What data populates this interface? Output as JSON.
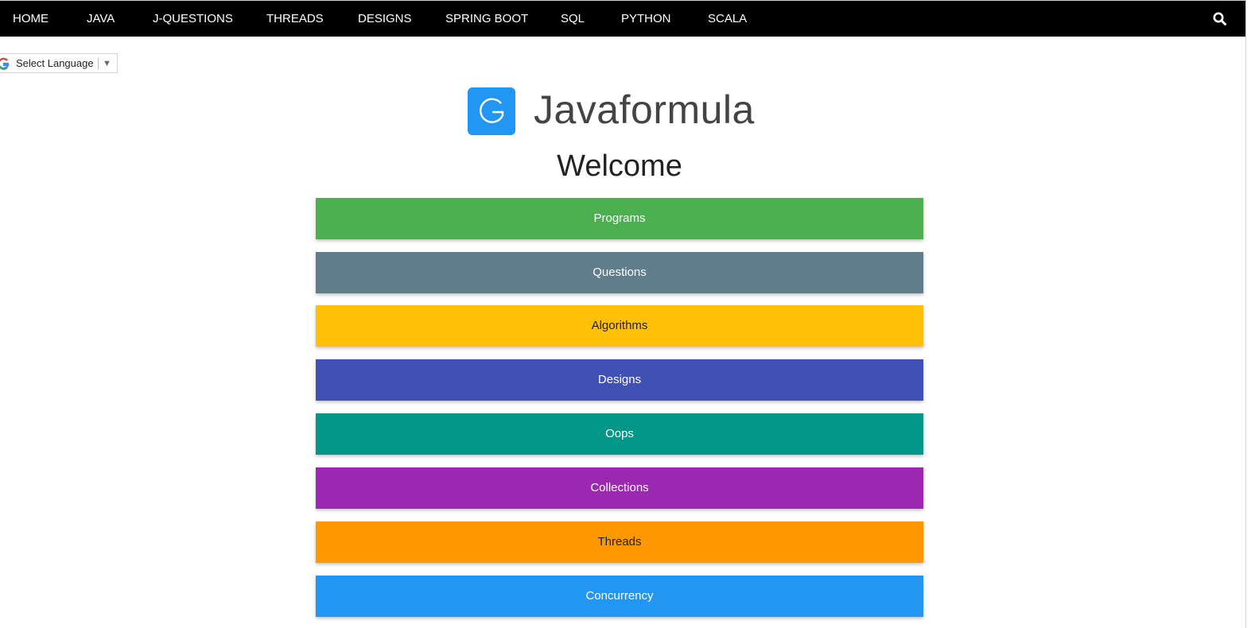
{
  "nav": {
    "items": [
      {
        "label": "HOME"
      },
      {
        "label": "JAVA"
      },
      {
        "label": "J-QUESTIONS"
      },
      {
        "label": "THREADS"
      },
      {
        "label": "DESIGNS"
      },
      {
        "label": "SPRING BOOT"
      },
      {
        "label": "SQL"
      },
      {
        "label": "PYTHON"
      },
      {
        "label": "SCALA"
      }
    ],
    "search_icon": "search-icon",
    "background": "#000000"
  },
  "translate": {
    "label": "Select Language",
    "arrow": "▼",
    "icon": "google-icon"
  },
  "logo": {
    "letter": "G",
    "text": "Javaformula",
    "color": "#2196f3"
  },
  "welcome": "Welcome",
  "categories": [
    {
      "label": "Programs",
      "color": "#4caf50",
      "text_color": "#ffffff"
    },
    {
      "label": "Questions",
      "color": "#607d8b",
      "text_color": "#ffffff"
    },
    {
      "label": "Algorithms",
      "color": "#ffc107",
      "text_color": "#222222"
    },
    {
      "label": "Designs",
      "color": "#3f51b5",
      "text_color": "#ffffff"
    },
    {
      "label": "Oops",
      "color": "#009688",
      "text_color": "#ffffff"
    },
    {
      "label": "Collections",
      "color": "#9c27b0",
      "text_color": "#ffffff"
    },
    {
      "label": "Threads",
      "color": "#ff9800",
      "text_color": "#222222"
    },
    {
      "label": "Concurrency",
      "color": "#2196f3",
      "text_color": "#ffffff"
    }
  ]
}
